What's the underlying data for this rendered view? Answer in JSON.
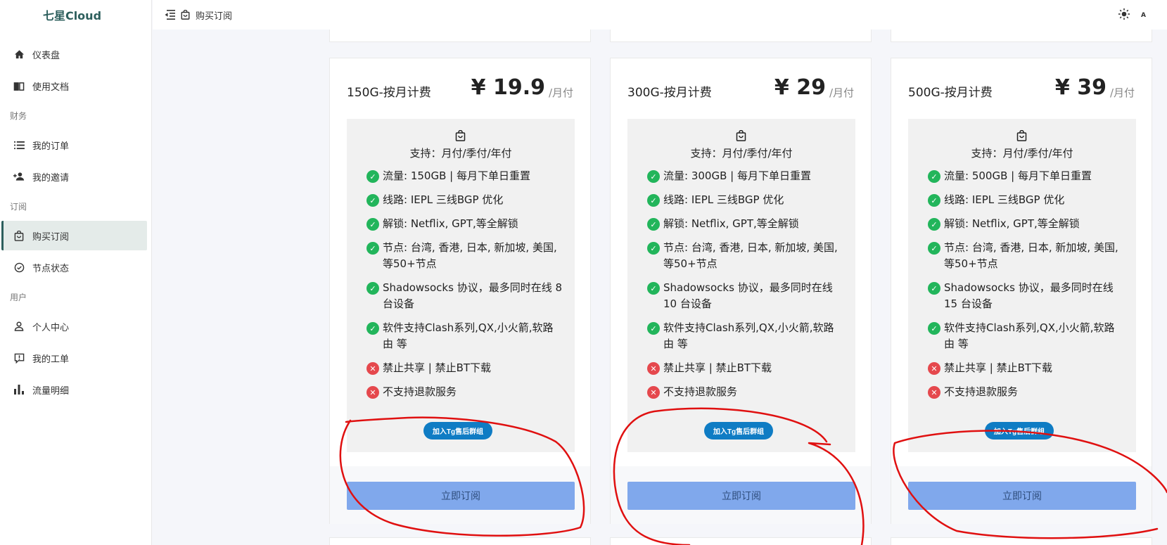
{
  "app": {
    "brand": "七星Cloud"
  },
  "sidebar": {
    "items": [
      {
        "label": "仪表盘",
        "icon": "home-icon"
      },
      {
        "label": "使用文档",
        "icon": "book-icon"
      }
    ],
    "section_finance": "财务",
    "finance_items": [
      {
        "label": "我的订单",
        "icon": "list-icon"
      },
      {
        "label": "我的邀请",
        "icon": "user-add-icon"
      }
    ],
    "section_subscribe": "订阅",
    "subscribe_items": [
      {
        "label": "购买订阅",
        "icon": "shopping-bag-icon",
        "active": true
      },
      {
        "label": "节点状态",
        "icon": "check-circle-icon"
      }
    ],
    "section_user": "用户",
    "user_items": [
      {
        "label": "个人中心",
        "icon": "person-icon"
      },
      {
        "label": "我的工单",
        "icon": "ticket-icon"
      },
      {
        "label": "流量明细",
        "icon": "bar-chart-icon"
      }
    ]
  },
  "header": {
    "title": "购买订阅",
    "lang_label": "A"
  },
  "plans": [
    {
      "name": "150G-按月计费",
      "price": "¥ 19.9",
      "period": "/月付",
      "support": "支持：月付/季付/年付",
      "features": [
        {
          "ok": true,
          "text": "流量: 150GB | 每月下单日重置"
        },
        {
          "ok": true,
          "text": "线路: IEPL 三线BGP 优化"
        },
        {
          "ok": true,
          "text": "解锁: Netflix, GPT,等全解锁"
        },
        {
          "ok": true,
          "text": "节点: 台湾, 香港, 日本, 新加坡, 美国, 等50+节点"
        },
        {
          "ok": true,
          "text": "Shadowsocks 协议，最多同时在线 8 台设备"
        },
        {
          "ok": true,
          "text": "软件支持Clash系列,QX,小火箭,软路由 等"
        },
        {
          "ok": false,
          "text": "禁止共享 | 禁止BT下载"
        },
        {
          "ok": false,
          "text": "不支持退款服务"
        }
      ],
      "tg_button": "加入Tg售后群组",
      "subscribe_button": "立即订阅"
    },
    {
      "name": "300G-按月计费",
      "price": "¥ 29",
      "period": "/月付",
      "support": "支持：月付/季付/年付",
      "features": [
        {
          "ok": true,
          "text": "流量: 300GB | 每月下单日重置"
        },
        {
          "ok": true,
          "text": "线路: IEPL 三线BGP 优化"
        },
        {
          "ok": true,
          "text": "解锁: Netflix, GPT,等全解锁"
        },
        {
          "ok": true,
          "text": "节点: 台湾, 香港, 日本, 新加坡, 美国, 等50+节点"
        },
        {
          "ok": true,
          "text": "Shadowsocks 协议，最多同时在线 10 台设备"
        },
        {
          "ok": true,
          "text": "软件支持Clash系列,QX,小火箭,软路由 等"
        },
        {
          "ok": false,
          "text": "禁止共享 | 禁止BT下载"
        },
        {
          "ok": false,
          "text": "不支持退款服务"
        }
      ],
      "tg_button": "加入Tg售后群组",
      "subscribe_button": "立即订阅"
    },
    {
      "name": "500G-按月计费",
      "price": "¥ 39",
      "period": "/月付",
      "support": "支持：月付/季付/年付",
      "features": [
        {
          "ok": true,
          "text": "流量: 500GB | 每月下单日重置"
        },
        {
          "ok": true,
          "text": "线路: IEPL 三线BGP 优化"
        },
        {
          "ok": true,
          "text": "解锁: Netflix, GPT,等全解锁"
        },
        {
          "ok": true,
          "text": "节点: 台湾, 香港, 日本, 新加坡, 美国, 等50+节点"
        },
        {
          "ok": true,
          "text": "Shadowsocks 协议，最多同时在线 15 台设备"
        },
        {
          "ok": true,
          "text": "软件支持Clash系列,QX,小火箭,软路由 等"
        },
        {
          "ok": false,
          "text": "禁止共享 | 禁止BT下载"
        },
        {
          "ok": false,
          "text": "不支持退款服务"
        }
      ],
      "tg_button": "加入Tg售后群组",
      "subscribe_button": "立即订阅"
    }
  ],
  "colors": {
    "brand": "#2d5f5d",
    "check": "#22b55b",
    "cross": "#e5484d",
    "tg_button": "#0f7cc4",
    "subscribe_button": "#80a8ec",
    "annotation": "#e01010"
  }
}
